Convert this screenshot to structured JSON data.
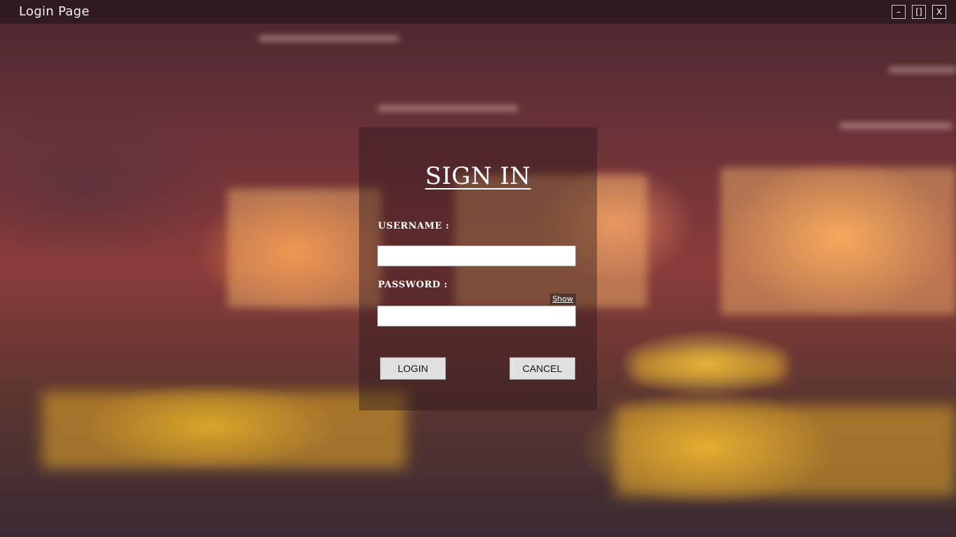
{
  "window": {
    "title": "Login Page",
    "minimize_label": "–",
    "maximize_label": "[]",
    "close_label": "X"
  },
  "login_form": {
    "heading": "SIGN IN",
    "username_label": "USERNAME :",
    "username_value": "",
    "password_label": "PASSWORD :",
    "password_value": "",
    "show_password_label": "Show",
    "login_button": "LOGIN",
    "cancel_button": "CANCEL"
  },
  "colors": {
    "panel_overlay": "#28161a",
    "button_face": "#e1e1e1",
    "heading_text": "#ffffff"
  },
  "icons": {
    "minimize": "minimize-icon",
    "maximize": "maximize-icon",
    "close": "close-icon"
  }
}
